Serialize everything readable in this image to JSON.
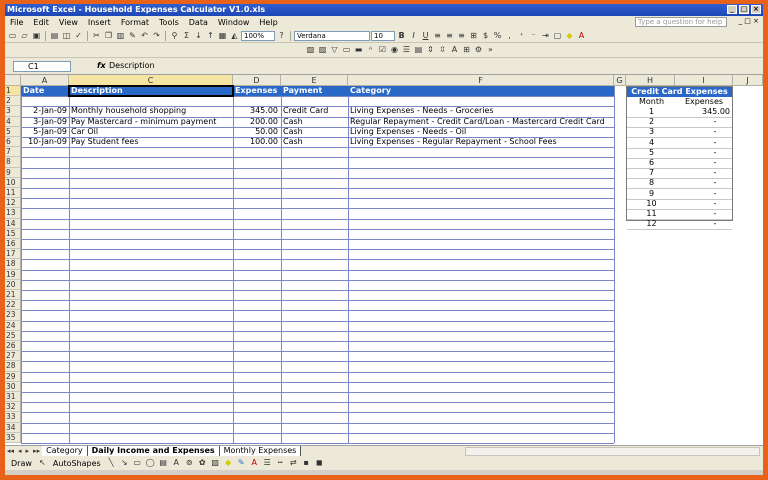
{
  "window": {
    "title": "Microsoft Excel - Household Expenses Calculator V1.0.xls",
    "controls": [
      "_",
      "□",
      "×"
    ]
  },
  "menu": {
    "items": [
      "File",
      "Edit",
      "View",
      "Insert",
      "Format",
      "Tools",
      "Data",
      "Window",
      "Help"
    ],
    "help_placeholder": "Type a question for help",
    "doc_controls": "_ □ ×"
  },
  "toolbar": {
    "zoom": "100%",
    "font": "Verdana",
    "font_size": "10"
  },
  "formula_bar": {
    "name_box": "C1",
    "fx": "fx",
    "content": "Description"
  },
  "columns": [
    "A",
    "C",
    "D",
    "E",
    "F",
    "G",
    "H",
    "I",
    "J"
  ],
  "table": {
    "headers": [
      "Date",
      "Description",
      "Expenses",
      "Payment",
      "Category"
    ],
    "rows": [
      {
        "date": "2-Jan-09",
        "description": "Monthly household shopping",
        "expenses": "345.00",
        "payment": "Credit Card",
        "category": "Living Expenses - Needs - Groceries"
      },
      {
        "date": "3-Jan-09",
        "description": "Pay Mastercard - minimum payment",
        "expenses": "200.00",
        "payment": "Cash",
        "category": "Regular Repayment - Credit Card/Loan - Mastercard Credit Card"
      },
      {
        "date": "5-Jan-09",
        "description": "Car Oil",
        "expenses": "50.00",
        "payment": "Cash",
        "category": "Living Expenses - Needs - Oil"
      },
      {
        "date": "10-Jan-09",
        "description": "Pay Student fees",
        "expenses": "100.00",
        "payment": "Cash",
        "category": "Living Expenses - Regular Repayment - School Fees"
      }
    ]
  },
  "row_numbers": [
    "1",
    "2",
    "3",
    "4",
    "5",
    "6",
    "7",
    "8",
    "9",
    "10",
    "11",
    "12",
    "13",
    "14",
    "15",
    "16",
    "17",
    "18",
    "19",
    "20",
    "21",
    "22",
    "23",
    "24",
    "25",
    "26",
    "27",
    "28",
    "29",
    "30",
    "31",
    "32",
    "33",
    "34",
    "35"
  ],
  "credit_card": {
    "title": "Credit Card Expenses",
    "month_header": "Month",
    "expenses_header": "Expenses",
    "rows": [
      {
        "month": "1",
        "value": "345.00"
      },
      {
        "month": "2",
        "value": "-"
      },
      {
        "month": "3",
        "value": "-"
      },
      {
        "month": "4",
        "value": "-"
      },
      {
        "month": "5",
        "value": "-"
      },
      {
        "month": "6",
        "value": "-"
      },
      {
        "month": "7",
        "value": "-"
      },
      {
        "month": "8",
        "value": "-"
      },
      {
        "month": "9",
        "value": "-"
      },
      {
        "month": "10",
        "value": "-"
      },
      {
        "month": "11",
        "value": "-"
      },
      {
        "month": "12",
        "value": "-"
      }
    ]
  },
  "sheet_tabs": [
    "Category",
    "Daily Income and Expenses",
    "Monthly Expenses"
  ],
  "active_tab": "Daily Income and Expenses",
  "drawing": {
    "draw_label": "Draw",
    "autoshapes_label": "AutoShapes"
  },
  "colors": {
    "header_blue": "#2a68c8",
    "gridline": "#7a86c8",
    "frame_orange": "#e8621a"
  }
}
